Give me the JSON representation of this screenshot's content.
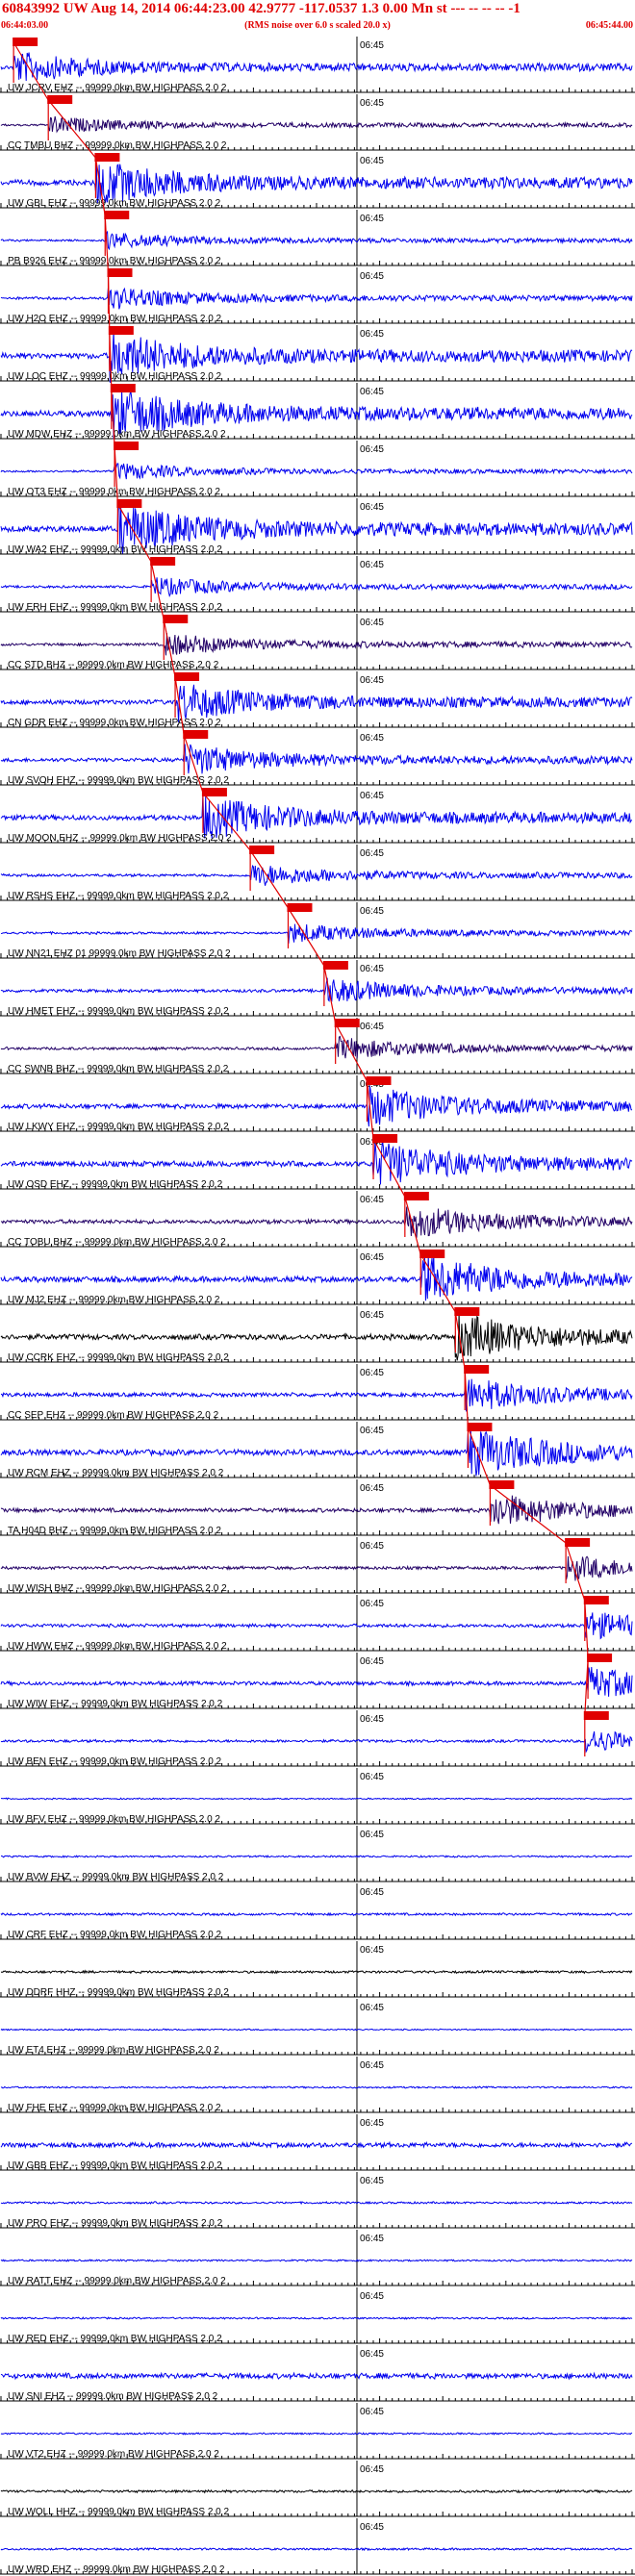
{
  "header": {
    "title": "60843992 UW Aug 14, 2014 06:44:23.00   42.9777 -117.0537  1.3 0.00 Mn st --- -- -- -- -1",
    "subtitle": "(RMS noise over 6.0 s scaled 20.0 x)",
    "time_start": "06:44:03.00",
    "time_end": "06:45:44.00"
  },
  "minute_label": "06:45",
  "colors": {
    "trace": "#0000ee",
    "pick": "#e00000",
    "label": "#000000",
    "axis": "#000000"
  },
  "traces": [
    {
      "label": "UW JCRV EHZ -- 99999.0km BW  HIGHPASS  2.0  2",
      "color": "#0000ee",
      "pick": 0.02,
      "amp": 0.55
    },
    {
      "label": "CC TMBU BHZ -- 99999.0km BW  HIGHPASS  2.0  2",
      "color": "#220066",
      "pick": 0.075,
      "amp": 0.3
    },
    {
      "label": "UW GBL EHZ -- 99999.0km BW  HIGHPASS  2.0  2",
      "color": "#0000ee",
      "pick": 0.15,
      "amp": 0.8
    },
    {
      "label": "PB B926 EHZ -- 99999.0km BW  HIGHPASS  2.0  2",
      "color": "#0000ee",
      "pick": 0.165,
      "amp": 0.3
    },
    {
      "label": "UW H2O EHZ -- 99999.0km BW  HIGHPASS  2.0  2",
      "color": "#0000ee",
      "pick": 0.17,
      "amp": 0.4
    },
    {
      "label": "UW LOC EHZ -- 99999.0km BW  HIGHPASS  2.0  2",
      "color": "#0000ee",
      "pick": 0.172,
      "amp": 0.85
    },
    {
      "label": "UW MDW EHZ -- 99999.0km BW  HIGHPASS  2.0  2",
      "color": "#0000ee",
      "pick": 0.175,
      "amp": 0.9
    },
    {
      "label": "UW OT3 EHZ -- 99999.0km BW  HIGHPASS  2.0  2",
      "color": "#0000ee",
      "pick": 0.18,
      "amp": 0.3
    },
    {
      "label": "UW WA2 EHZ -- 99999.0km BW  HIGHPASS  2.0  2",
      "color": "#0000ee",
      "pick": 0.185,
      "amp": 0.9
    },
    {
      "label": "UW ERH EHZ -- 99999.0km BW  HIGHPASS  2.0  2",
      "color": "#0000ee",
      "pick": 0.238,
      "amp": 0.35
    },
    {
      "label": "CC STD BHZ -- 99999.0km BW  HIGHPASS  2.0  2",
      "color": "#220066",
      "pick": 0.258,
      "amp": 0.4
    },
    {
      "label": "CN GDR EHZ -- 99999.0km BW  HIGHPASS  2.0  2",
      "color": "#0000ee",
      "pick": 0.276,
      "amp": 0.7
    },
    {
      "label": "UW SVOH EHZ -- 99999.0km BW  HIGHPASS  2.0  2",
      "color": "#0000ee",
      "pick": 0.29,
      "amp": 0.55
    },
    {
      "label": "UW MOON EHZ -- 99999.0km BW  HIGHPASS  2.0  2",
      "color": "#0000ee",
      "pick": 0.32,
      "amp": 0.75
    },
    {
      "label": "UW RSHS EHZ -- 99999.0km BW  HIGHPASS  2.0  2",
      "color": "#0000ee",
      "pick": 0.395,
      "amp": 0.4
    },
    {
      "label": "UW NN21 EHZ 01 99999.0km BW  HIGHPASS  2.0  2",
      "color": "#0000ee",
      "pick": 0.455,
      "amp": 0.35
    },
    {
      "label": "UW HMET EHZ -- 99999.0km BW  HIGHPASS  2.0  2",
      "color": "#0000ee",
      "pick": 0.512,
      "amp": 0.45
    },
    {
      "label": "CC SWNB BHZ -- 99999.0km BW  HIGHPASS  2.0  2",
      "color": "#220066",
      "pick": 0.53,
      "amp": 0.4
    },
    {
      "label": "UW LKWY EHZ -- 99999.0km BW  HIGHPASS  2.0  2",
      "color": "#0000ee",
      "pick": 0.58,
      "amp": 0.7
    },
    {
      "label": "UW OSD EHZ -- 99999.0km BW  HIGHPASS  2.0  2",
      "color": "#0000ee",
      "pick": 0.59,
      "amp": 0.8
    },
    {
      "label": "CC TOBU BHZ -- 99999.0km BW  HIGHPASS  2.0  2",
      "color": "#220066",
      "pick": 0.64,
      "amp": 0.6
    },
    {
      "label": "UW MJ2 EHZ -- 99999.0km BW  HIGHPASS  2.0  2",
      "color": "#0000ee",
      "pick": 0.665,
      "amp": 0.85
    },
    {
      "label": "UW CCRK EHZ -- 99999.0km BW  HIGHPASS  2.0  2",
      "color": "#000000",
      "pick": 0.72,
      "amp": 0.8
    },
    {
      "label": "CC SEP EHZ -- 99999.0km BW  HIGHPASS  2.0  2",
      "color": "#0000ee",
      "pick": 0.735,
      "amp": 0.6
    },
    {
      "label": "UW RCM EHZ -- 99999.0km BW  HIGHPASS  2.0  2",
      "color": "#0000ee",
      "pick": 0.74,
      "amp": 0.85
    },
    {
      "label": "TA H04D BHZ -- 99999.0km BW  HIGHPASS  2.0  2",
      "color": "#220066",
      "pick": 0.775,
      "amp": 0.6
    },
    {
      "label": "UW WISH BHZ -- 99999.0km BW  HIGHPASS  2.0  2",
      "color": "#220066",
      "pick": 0.895,
      "amp": 0.45
    },
    {
      "label": "UW HWW EHZ -- 99999.0km BW  HIGHPASS  2.0  2",
      "color": "#0000ee",
      "pick": 0.925,
      "amp": 0.5
    },
    {
      "label": "UW WIW EHZ -- 99999.0km BW  HIGHPASS  2.0  2",
      "color": "#0000ee",
      "pick": 0.93,
      "amp": 0.55
    },
    {
      "label": "UW BEN EHZ -- 99999.0km BW  HIGHPASS  2.0  2",
      "color": "#0000ee",
      "pick": 0.925,
      "amp": 0.4
    },
    {
      "label": "UW BFV EHZ -- 99999.0km BW  HIGHPASS  2.0  2",
      "color": "#0000ee",
      "pick": null,
      "amp": 0.2
    },
    {
      "label": "UW BVW EHZ -- 99999.0km BW  HIGHPASS  2.0  2",
      "color": "#0000ee",
      "pick": null,
      "amp": 0.25
    },
    {
      "label": "UW CRF EHZ -- 99999.0km BW  HIGHPASS  2.0  2",
      "color": "#0000ee",
      "pick": null,
      "amp": 0.35
    },
    {
      "label": "UW DDRF HHZ -- 99999.0km BW  HIGHPASS  2.0  2",
      "color": "#000000",
      "pick": null,
      "amp": 0.35
    },
    {
      "label": "UW ET4 EHZ -- 99999.0km BW  HIGHPASS  2.0  2",
      "color": "#0000ee",
      "pick": null,
      "amp": 0.2
    },
    {
      "label": "UW FHE EHZ -- 99999.0km BW  HIGHPASS  2.0  2",
      "color": "#0000ee",
      "pick": null,
      "amp": 0.25
    },
    {
      "label": "UW GBB EHZ -- 99999.0km BW  HIGHPASS  2.0  2",
      "color": "#0000ee",
      "pick": null,
      "amp": 0.7
    },
    {
      "label": "UW PRO EHZ -- 99999.0km BW  HIGHPASS  2.0  2",
      "color": "#0000ee",
      "pick": null,
      "amp": 0.3
    },
    {
      "label": "UW RATT EHZ -- 99999.0km BW  HIGHPASS  2.0  2",
      "color": "#0000ee",
      "pick": null,
      "amp": 0.25
    },
    {
      "label": "UW RED EHZ -- 99999.0km BW  HIGHPASS  2.0  2",
      "color": "#0000ee",
      "pick": null,
      "amp": 0.25
    },
    {
      "label": "UW SNI EHZ -- 99999.0km BW  HIGHPASS  2.0  2",
      "color": "#0000ee",
      "pick": null,
      "amp": 0.8
    },
    {
      "label": "UW VT2 EHZ -- 99999.0km BW  HIGHPASS  2.0  2",
      "color": "#0000ee",
      "pick": null,
      "amp": 0.25
    },
    {
      "label": "UW WOLL HHZ -- 99999.0km BW  HIGHPASS  2.0  2",
      "color": "#000000",
      "pick": null,
      "amp": 0.35
    },
    {
      "label": "UW WRD EHZ -- 99999.0km BW  HIGHPASS  2.0  2",
      "color": "#0000ee",
      "pick": null,
      "amp": 0.3
    }
  ]
}
